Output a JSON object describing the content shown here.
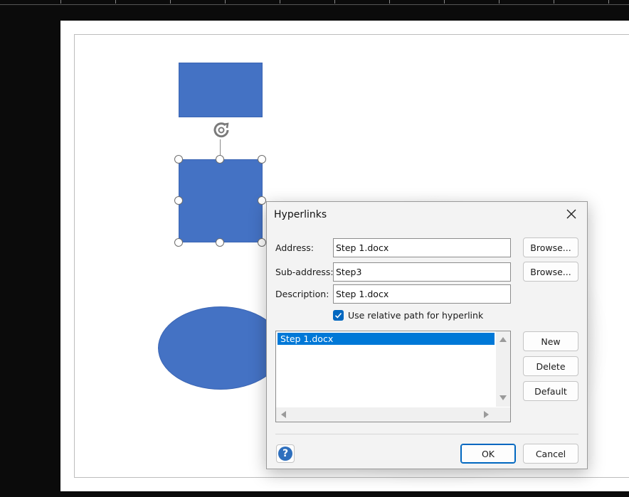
{
  "dialog": {
    "title": "Hyperlinks",
    "address_label": "Address:",
    "address_value": "Step 1.docx",
    "subaddress_label": "Sub-address:",
    "subaddress_value": "Step3",
    "description_label": "Description:",
    "description_value": "Step 1.docx",
    "browse_label": "Browse...",
    "relative_path_label": "Use relative path for hyperlink",
    "relative_path_checked": true,
    "list_items": [
      "Step 1.docx"
    ],
    "new_label": "New",
    "delete_label": "Delete",
    "default_label": "Default",
    "ok_label": "OK",
    "cancel_label": "Cancel"
  },
  "canvas": {
    "shape_color": "#4472c4",
    "shapes": [
      "rectangle",
      "rectangle-selected",
      "ellipse"
    ]
  },
  "colors": {
    "accent": "#0067c0",
    "selection": "#0078d7",
    "help": "#2e6fbd"
  }
}
